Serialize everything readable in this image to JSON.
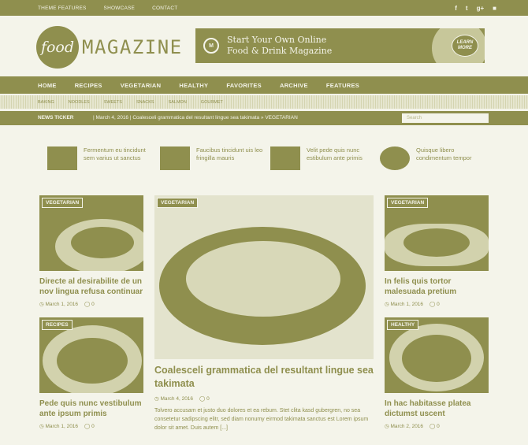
{
  "topbar": {
    "links": [
      "THEME FEATURES",
      "SHOWCASE",
      "CONTACT"
    ],
    "social": [
      "f",
      "t",
      "g+",
      "rss"
    ]
  },
  "logo": {
    "badge": "food",
    "word": "MAGAZINE"
  },
  "banner": {
    "badge": "M",
    "line1": "Start Your Own Online",
    "line2": "Food & Drink Magazine",
    "cta": "LEARN MORE"
  },
  "nav": {
    "main": [
      "HOME",
      "RECIPES",
      "VEGETARIAN",
      "HEALTHY",
      "FAVORITES",
      "ARCHIVE",
      "FEATURES"
    ],
    "sub": [
      "BAKING",
      "NOODLES",
      "SWEETS",
      "SNACKS",
      "SALMON",
      "GOURMET"
    ]
  },
  "ticker": {
    "label": "NEWS TICKER",
    "text": "| March 4, 2016 | Coalesceli grammatica del resultant lingue sea takimata   »   VEGETARIAN",
    "search_placeholder": "Search"
  },
  "mini_posts": [
    {
      "title": "Fermentum eu tincidunt sem varius ut sanctus"
    },
    {
      "title": "Faucibus tincidunt uis leo fringilla mauris"
    },
    {
      "title": "Velit pede quis nunc estibulum ante primis"
    },
    {
      "title": "Quisque libero condimentum tempor"
    }
  ],
  "cards": {
    "left_top": {
      "tag": "VEGETARIAN",
      "title": "Directe al desirabilite de un nov lingua refusa continuar",
      "date": "March 1, 2016",
      "comments": "0"
    },
    "left_bottom": {
      "tag": "RECIPES",
      "title": "Pede quis nunc vestibulum ante ipsum primis",
      "date": "March 1, 2016",
      "comments": "0"
    },
    "right_top": {
      "tag": "VEGETARIAN",
      "title": "In felis quis tortor malesuada pretium",
      "date": "March 1, 2016",
      "comments": "0"
    },
    "right_bottom": {
      "tag": "HEALTHY",
      "title": "In hac habitasse platea dictumst uscent",
      "date": "March 2, 2016",
      "comments": "0"
    }
  },
  "feature": {
    "tag": "VEGETARIAN",
    "title": "Coalesceli grammatica del resultant lingue sea takimata",
    "date": "March 4, 2016",
    "comments": "0",
    "excerpt": "Tolvero accusam et justo duo dolores et ea rebum. Stet clita kasd gubergren, no sea consetetur sadipscing elitr, sed diam nonumy eirmod takimata sanctus est Lorem ipsum dolor sit amet. Duis autem [...]"
  },
  "colors": {
    "accent": "#8f8f4e",
    "background": "#f4f4ea"
  }
}
